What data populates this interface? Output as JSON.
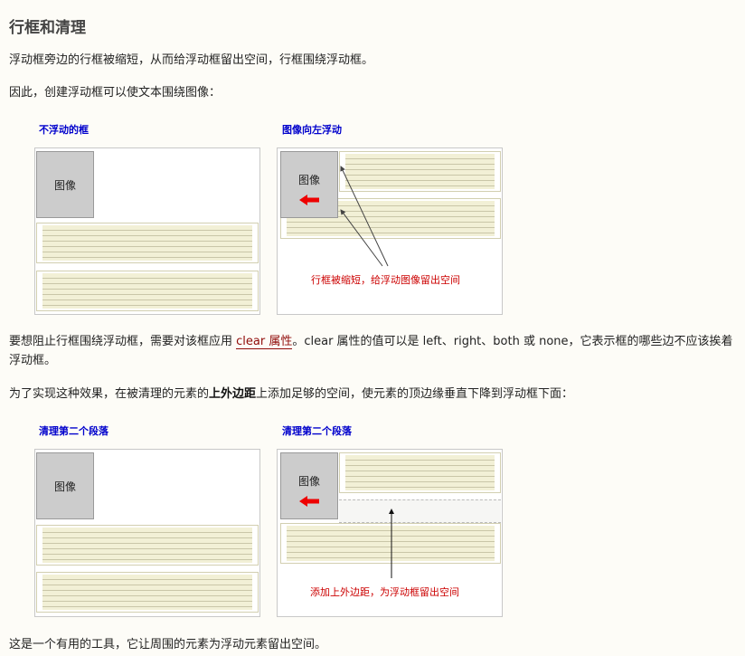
{
  "heading": "行框和清理",
  "p1": "浮动框旁边的行框被缩短，从而给浮动框留出空间，行框围绕浮动框。",
  "p2": "因此，创建浮动框可以使文本围绕图像：",
  "figure1": {
    "left_title": "不浮动的框",
    "right_title": "图像向左浮动",
    "image_label": "图像",
    "caption": "行框被缩短，给浮动图像留出空间"
  },
  "p3": {
    "before": "要想阻止行框围绕浮动框，需要对该框应用 ",
    "link": "clear 属性",
    "after": "。clear 属性的值可以是 left、right、both 或 none，它表示框的哪些边不应该挨着浮动框。"
  },
  "p4": {
    "before": "为了实现这种效果，在被清理的元素的",
    "bold": "上外边距",
    "after": "上添加足够的空间，使元素的顶边缘垂直下降到浮动框下面："
  },
  "figure2": {
    "left_title": "清理第二个段落",
    "right_title": "清理第二个段落",
    "image_label": "图像",
    "caption": "添加上外边距，为浮动框留出空间"
  },
  "p5": "这是一个有用的工具，它让周围的元素为浮动元素留出空间。",
  "colors": {
    "figure_title": "#0000cc",
    "caption": "#cc0000",
    "link": "#900b09",
    "arrow": "#ee0000"
  },
  "icons": [
    "left-arrow-icon"
  ]
}
